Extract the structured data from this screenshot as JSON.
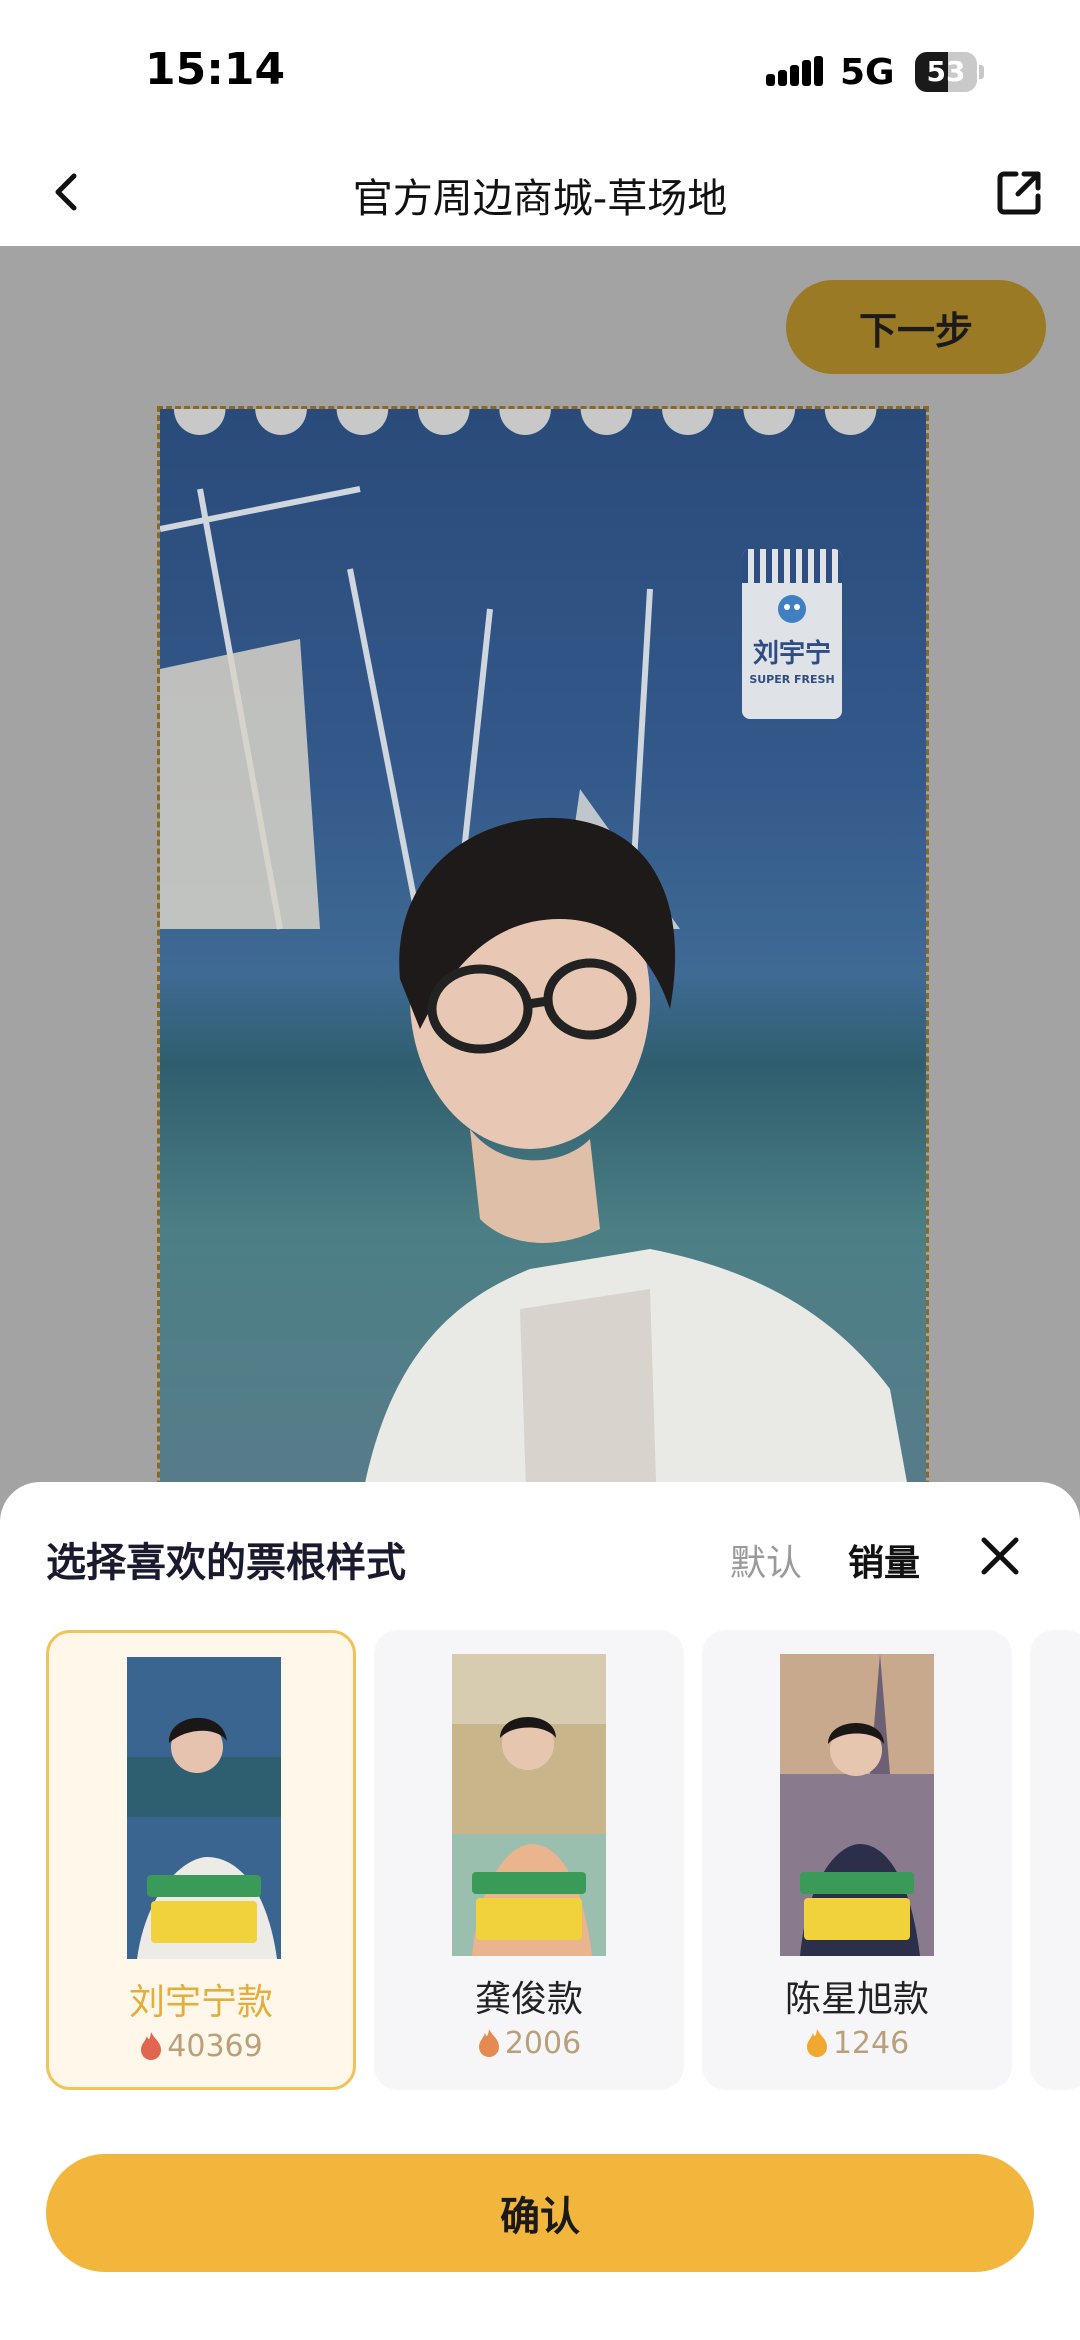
{
  "status": {
    "time": "15:14",
    "network": "5G",
    "battery": "53",
    "battery_level": 0.53
  },
  "nav": {
    "title": "官方周边商城-草场地"
  },
  "canvas": {
    "next_label": "下一步",
    "tag_name": "刘宇宁",
    "tag_sub": "SUPER FRESH"
  },
  "sheet": {
    "title": "选择喜欢的票根样式",
    "sort_default": "默认",
    "sort_sales": "销量",
    "cards": [
      {
        "name": "刘宇宁款",
        "count": "40369",
        "selected": true,
        "flame_color": "#e0664f"
      },
      {
        "name": "龚俊款",
        "count": "2006",
        "selected": false,
        "flame_color": "#e58a50"
      },
      {
        "name": "陈星旭款",
        "count": "1246",
        "selected": false,
        "flame_color": "#f0a830"
      }
    ],
    "confirm_label": "确认"
  },
  "colors": {
    "accent": "#f3b63c",
    "dim_accent": "#9b7a25",
    "selected_text": "#e4ae3a"
  }
}
